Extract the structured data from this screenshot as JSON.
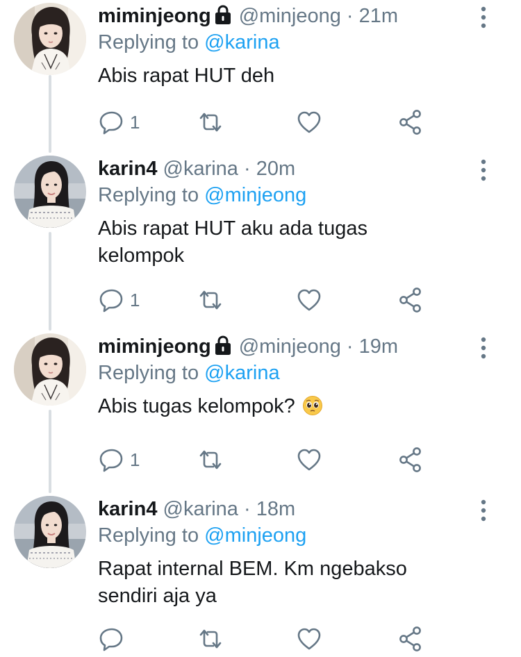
{
  "colors": {
    "text": "#14171a",
    "secondary": "#657786",
    "mention": "#1da1f2",
    "thread_line": "#d9dee2"
  },
  "tweets": [
    {
      "display_name": "miminjeong",
      "protected": true,
      "handle": "@minjeong",
      "time": "21m",
      "replying_label": "Replying to",
      "replying_to": "@karina",
      "text": "Abis rapat HUT deh",
      "reply_count": "1",
      "avatar": "minjeong-avatar"
    },
    {
      "display_name": "karin4",
      "protected": false,
      "handle": "@karina",
      "time": "20m",
      "replying_label": "Replying to",
      "replying_to": "@minjeong",
      "text": "Abis rapat HUT aku ada tugas\nkelompok",
      "reply_count": "1",
      "avatar": "karina-avatar"
    },
    {
      "display_name": "miminjeong",
      "protected": true,
      "handle": "@minjeong",
      "time": "19m",
      "replying_label": "Replying to",
      "replying_to": "@karina",
      "text": "Abis tugas kelompok?",
      "emoji": "pleading-face-emoji",
      "reply_count": "1",
      "avatar": "minjeong-avatar"
    },
    {
      "display_name": "karin4",
      "protected": false,
      "handle": "@karina",
      "time": "18m",
      "replying_label": "Replying to",
      "replying_to": "@minjeong",
      "text": "Rapat internal BEM. Km ngebakso\nsendiri aja ya",
      "reply_count": "",
      "avatar": "karina-avatar"
    }
  ],
  "separator": "·",
  "icons": {
    "reply": "reply-icon",
    "retweet": "retweet-icon",
    "like": "heart-icon",
    "share": "share-icon",
    "more": "more-vertical-icon",
    "lock": "lock-icon"
  }
}
